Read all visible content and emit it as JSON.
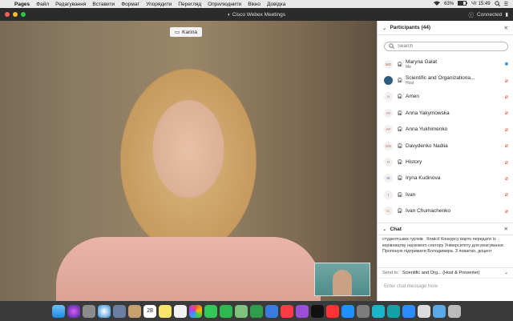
{
  "menubar": {
    "app": "Pages",
    "items": [
      "Файл",
      "Редагування",
      "Вставити",
      "Формат",
      "Упорядити",
      "Перегляд",
      "Оприлюднити",
      "Вікно",
      "Довідка"
    ],
    "battery": "63%",
    "clock": "Чт 15:49"
  },
  "window": {
    "title": "Cisco Webex Meetings",
    "connection": "Connected"
  },
  "video": {
    "speaker_name": "Karina"
  },
  "participants": {
    "title": "Participants (44)",
    "search_placeholder": "Search",
    "list": [
      {
        "initials": "MG",
        "name": "Maryna Galat",
        "sub": "Me",
        "mic": "video"
      },
      {
        "initials": "",
        "name": "Scientific and Organizationa...",
        "sub": "Host",
        "mic": "muted"
      },
      {
        "initials": "A",
        "name": "Amen",
        "sub": "",
        "mic": "muted"
      },
      {
        "initials": "AY",
        "name": "Anna Yakymowska",
        "sub": "",
        "mic": "muted"
      },
      {
        "initials": "AY",
        "name": "Anna Yukhimenko",
        "sub": "",
        "mic": "muted"
      },
      {
        "initials": "DN",
        "name": "Davydenko Nadiia",
        "sub": "",
        "mic": "muted"
      },
      {
        "initials": "H",
        "name": "History",
        "sub": "",
        "mic": "muted"
      },
      {
        "initials": "IK",
        "name": "Iryna Kudinova",
        "sub": "",
        "mic": "muted"
      },
      {
        "initials": "I",
        "name": "Ivan",
        "sub": "",
        "mic": "muted"
      },
      {
        "initials": "IC",
        "name": "Ivan Chumachenko",
        "sub": "",
        "mic": "muted"
      }
    ]
  },
  "chat": {
    "title": "Chat",
    "message": "студентських гуртків . Комісії Конкурсу варто передати їх керівництву наукового сектору Університету для реагування. Пропоную підтримати Володимира. З повагою, доцент",
    "send_to_label": "Send to:",
    "send_to_value": "Scientific and Org... (Host & Presenter)",
    "input_placeholder": "Enter chat message here"
  },
  "dock": {
    "apps": [
      "finder",
      "siri",
      "launchpad",
      "safari",
      "photos-viewer",
      "contacts",
      "calendar",
      "notes",
      "reminders",
      "photos",
      "messages",
      "facetime",
      "maps",
      "numbers",
      "keynote",
      "music",
      "podcasts",
      "tv",
      "news",
      "app-store",
      "system-preferences",
      "webex",
      "webex-meetings",
      "zoom",
      "preview",
      "folder",
      "trash"
    ],
    "calendar_day": "28"
  },
  "colors": {
    "accent": "#2a8bd6",
    "muted_mic": "#d2553c"
  }
}
